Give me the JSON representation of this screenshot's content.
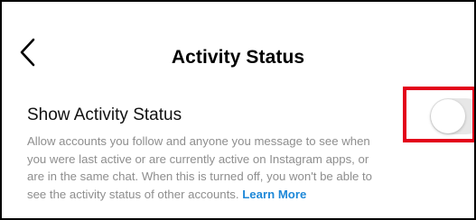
{
  "header": {
    "title": "Activity Status"
  },
  "setting": {
    "title": "Show Activity Status",
    "description": "Allow accounts you follow and anyone you message to see when you were last active or are currently active on Instagram apps, or are in the same chat. When this is turned off, you won't be able to see the activity status of other accounts.",
    "learn_more": "Learn More",
    "enabled": false
  },
  "icons": {
    "back": "chevron-left-icon"
  },
  "colors": {
    "link": "#1e88d8",
    "highlight": "#e3001b",
    "toggle_track_off": "#e7e7e7"
  }
}
